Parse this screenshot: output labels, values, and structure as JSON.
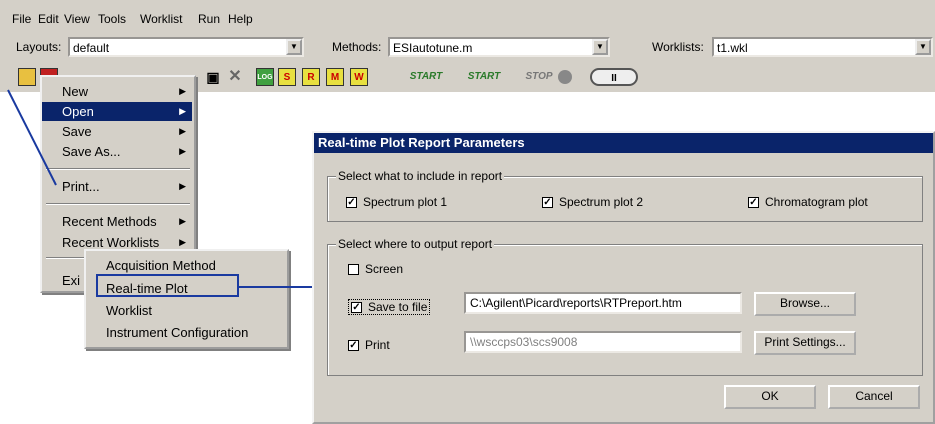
{
  "menubar": [
    "File",
    "Edit",
    "View",
    "Tools",
    "Worklist",
    "Run",
    "Help"
  ],
  "layouts": {
    "label": "Layouts:",
    "value": "default"
  },
  "methods": {
    "label": "Methods:",
    "value": "ESIautotune.m"
  },
  "worklists": {
    "label": "Worklists:",
    "value": "t1.wkl"
  },
  "toolbar": {
    "log": "LOG",
    "s": "S",
    "r": "R",
    "m": "M",
    "w": "W",
    "start1": "START",
    "start2": "START",
    "stop": "STOP",
    "pause": "II"
  },
  "file_menu": {
    "items": [
      "New",
      "Open",
      "Save",
      "Save As...",
      "Print...",
      "Recent Methods",
      "Recent Worklists",
      "Exi"
    ]
  },
  "print_submenu": {
    "items": [
      "Acquisition Method",
      "Real-time Plot",
      "Worklist",
      "Instrument Configuration"
    ]
  },
  "dialog": {
    "title": "Real-time Plot Report Parameters",
    "group1": {
      "legend": "Select what to include in report",
      "spectrum1": "Spectrum plot 1",
      "spectrum2": "Spectrum plot 2",
      "chromatogram": "Chromatogram plot"
    },
    "group2": {
      "legend": "Select where to output report",
      "screen": "Screen",
      "save_to_file": "Save to file",
      "save_path": "C:\\Agilent\\Picard\\reports\\RTPreport.htm",
      "browse": "Browse...",
      "print": "Print",
      "printer": "\\\\wsccps03\\scs9008",
      "print_settings": "Print Settings..."
    },
    "ok": "OK",
    "cancel": "Cancel"
  },
  "colors": {
    "title": "#0a246a",
    "callout": "#1a3aa0",
    "face": "#d4d0c8"
  }
}
